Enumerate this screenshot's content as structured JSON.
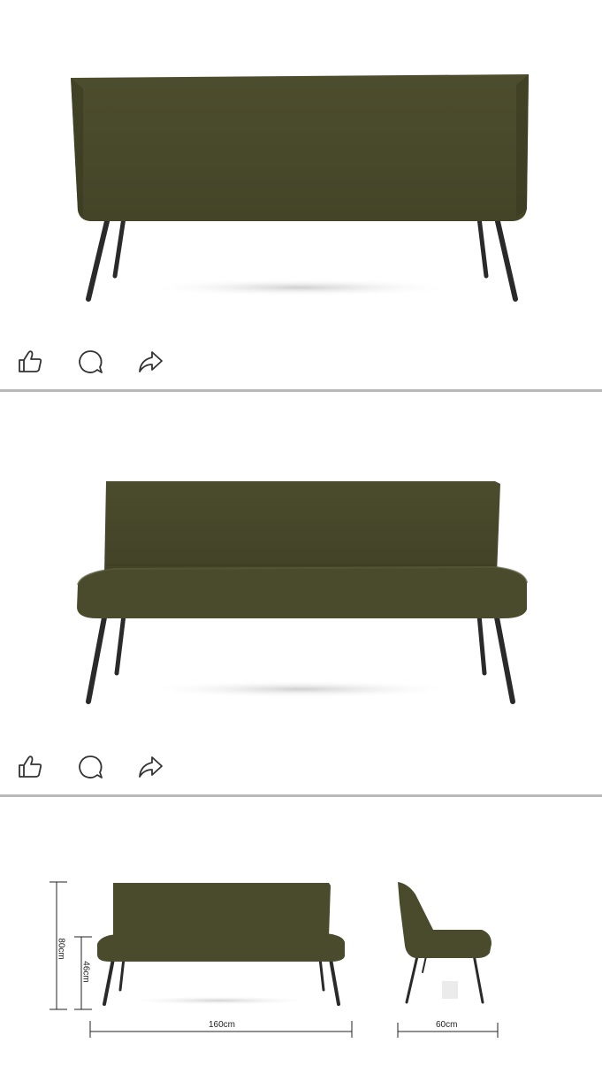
{
  "colors": {
    "fabric": "#4a4a2c",
    "fabric_dark": "#3f3f25",
    "fabric_light": "#55553a",
    "legs": "#2a2a2a",
    "divider": "#b9b9b9",
    "icon": "#333333",
    "shadow": "#d9d9d9"
  },
  "posts": [
    {
      "image_subject": "sofa-back-view",
      "actions": [
        {
          "icon": "thumbs-up-icon",
          "name": "like"
        },
        {
          "icon": "comment-icon",
          "name": "comment"
        },
        {
          "icon": "share-icon",
          "name": "share"
        }
      ]
    },
    {
      "image_subject": "sofa-front-view",
      "actions": [
        {
          "icon": "thumbs-up-icon",
          "name": "like"
        },
        {
          "icon": "comment-icon",
          "name": "comment"
        },
        {
          "icon": "share-icon",
          "name": "share"
        }
      ]
    },
    {
      "image_subject": "sofa-dimensions",
      "dimensions": {
        "total_height": "80cm",
        "seat_height": "46cm",
        "width": "160cm",
        "depth": "60cm"
      }
    }
  ]
}
